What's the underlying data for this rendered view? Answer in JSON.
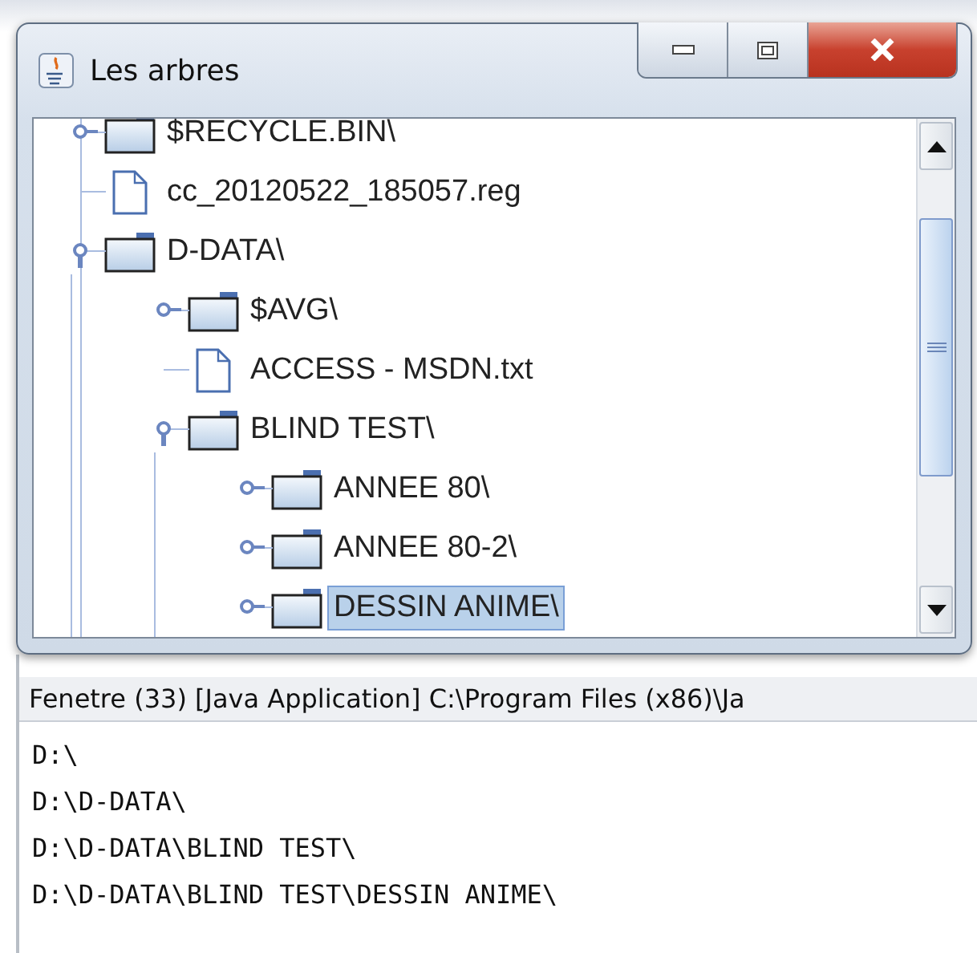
{
  "window": {
    "title": "Les arbres"
  },
  "tree": [
    {
      "kind": "folder",
      "label": "$RECYCLE.BIN\\",
      "expanded": false,
      "selected": false
    },
    {
      "kind": "file",
      "label": "cc_20120522_185057.reg",
      "selected": false
    },
    {
      "kind": "folder",
      "label": "D-DATA\\",
      "expanded": true,
      "selected": false,
      "children": [
        {
          "kind": "folder",
          "label": "$AVG\\",
          "expanded": false,
          "selected": false
        },
        {
          "kind": "file",
          "label": "ACCESS - MSDN.txt",
          "selected": false
        },
        {
          "kind": "folder",
          "label": "BLIND TEST\\",
          "expanded": true,
          "selected": false,
          "children": [
            {
              "kind": "folder",
              "label": "ANNEE 80\\",
              "expanded": false,
              "selected": false
            },
            {
              "kind": "folder",
              "label": "ANNEE 80-2\\",
              "expanded": false,
              "selected": false
            },
            {
              "kind": "folder",
              "label": "DESSIN ANIME\\",
              "expanded": false,
              "selected": true
            }
          ]
        }
      ]
    }
  ],
  "console": {
    "header": "Fenetre (33) [Java Application] C:\\Program Files (x86)\\Ja",
    "lines": [
      "D:\\",
      "D:\\D-DATA\\",
      "D:\\D-DATA\\BLIND TEST\\",
      "D:\\D-DATA\\BLIND TEST\\DESSIN ANIME\\"
    ]
  }
}
